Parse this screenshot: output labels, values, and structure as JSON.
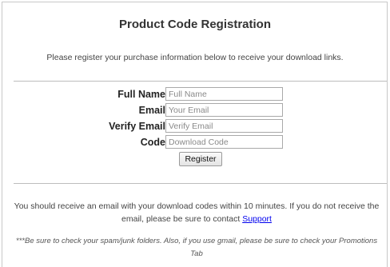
{
  "page_title": "Product Code Registration",
  "intro_text": "Please register your purchase information below to receive your download links.",
  "form": {
    "full_name": {
      "label": "Full Name",
      "placeholder": "Full Name",
      "value": ""
    },
    "email": {
      "label": "Email",
      "placeholder": "Your Email",
      "value": ""
    },
    "verify_email": {
      "label": "Verify Email",
      "placeholder": "Verify Email",
      "value": ""
    },
    "code": {
      "label": "Code",
      "placeholder": "Download Code",
      "value": ""
    },
    "register_label": "Register"
  },
  "notice": {
    "text": "You should receive an email with your download codes within 10 minutes. If you do not receive the email, please be sure to contact ",
    "link_label": "Support"
  },
  "spam_note": "***Be sure to check your spam/junk folders. Also, if you use gmail, please be sure to check your Promotions Tab",
  "colors": {
    "link": "#0000ee",
    "border": "#c8c8c8"
  }
}
